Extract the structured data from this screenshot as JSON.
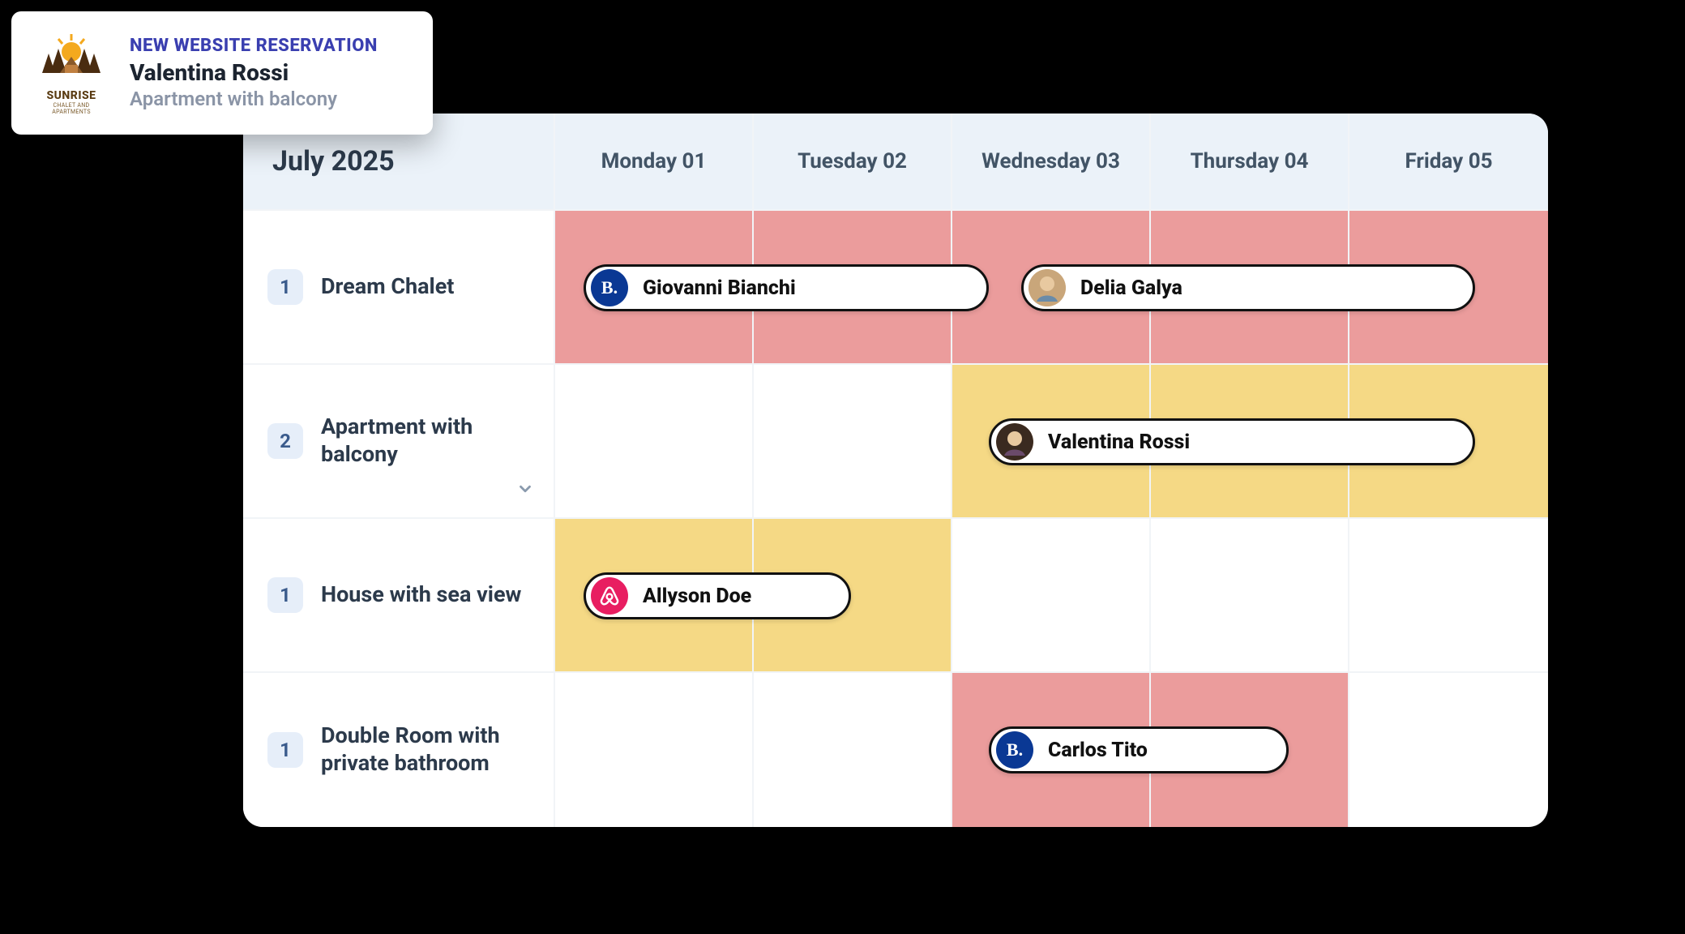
{
  "toast": {
    "property_brand": "SUNRISE",
    "property_tagline": "CHALET AND APARTMENTS",
    "kicker": "NEW WEBSITE RESERVATION",
    "guest_name": "Valentina Rossi",
    "room_name": "Apartment with balcony"
  },
  "calendar": {
    "title": "July 2025",
    "days": [
      {
        "label": "Monday 01"
      },
      {
        "label": "Tuesday 02"
      },
      {
        "label": "Wednesday 03"
      },
      {
        "label": "Thursday 04"
      },
      {
        "label": "Friday 05"
      }
    ],
    "rooms": [
      {
        "count": "1",
        "name": "Dream Chalet",
        "expandable": false
      },
      {
        "count": "2",
        "name": "Apartment with balcony",
        "expandable": true
      },
      {
        "count": "1",
        "name": "House with sea view",
        "expandable": false
      },
      {
        "count": "1",
        "name": "Double Room with private bathroom",
        "expandable": false
      }
    ],
    "bookings": [
      {
        "row": 0,
        "source": "booking",
        "guest": "Giovanni Bianchi"
      },
      {
        "row": 0,
        "source": "avatar",
        "guest": "Delia Galya"
      },
      {
        "row": 1,
        "source": "avatar",
        "guest": "Valentina Rossi"
      },
      {
        "row": 2,
        "source": "airbnb",
        "guest": "Allyson Doe"
      },
      {
        "row": 3,
        "source": "booking",
        "guest": "Carlos Tito"
      }
    ],
    "colors": {
      "busy_red": "#eb9c9c",
      "busy_yellow": "#f5d985"
    }
  }
}
